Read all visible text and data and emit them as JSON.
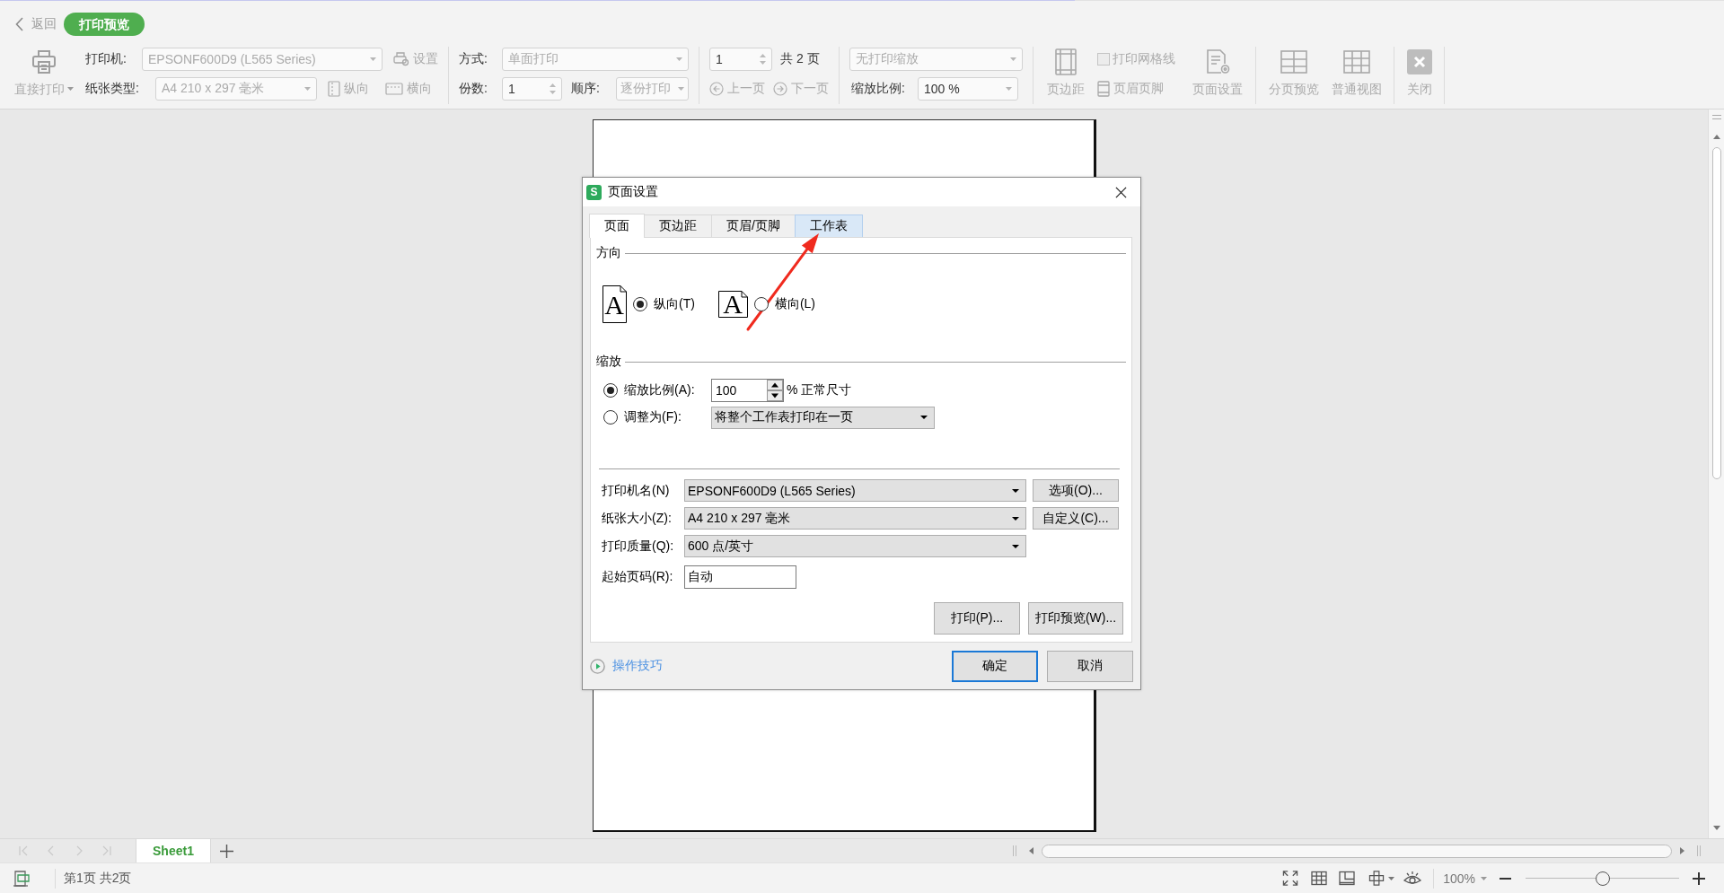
{
  "top_bar": {
    "back": "返回",
    "mode_badge": "打印预览"
  },
  "toolbar": {
    "direct_print": {
      "label": "直接打印",
      "disabled": true
    },
    "printer": {
      "label": "打印机:",
      "value": "EPSONF600D9 (L565 Series)",
      "disabled": true
    },
    "printer_settings": {
      "label": "设置",
      "disabled": true
    },
    "paper_type": {
      "label": "纸张类型:",
      "value": "A4 210 x 297 毫米",
      "disabled": true
    },
    "orientation": [
      {
        "kind": "portrait",
        "label": "纵向",
        "disabled": true
      },
      {
        "kind": "landscape",
        "label": "横向",
        "disabled": true
      }
    ],
    "print_mode": {
      "label": "方式:",
      "value": "单面打印",
      "disabled": true
    },
    "copies": {
      "label": "份数:",
      "value": "1"
    },
    "order": {
      "label": "顺序:",
      "value": "逐份打印",
      "disabled": true
    },
    "page_number": {
      "value": "1",
      "total": "共 2 页"
    },
    "page_nav": [
      {
        "kind": "prev",
        "label": "上一页",
        "disabled": true
      },
      {
        "kind": "next",
        "label": "下一页",
        "disabled": true
      }
    ],
    "print_scaling": {
      "value": "无打印缩放",
      "disabled": true
    },
    "zoom": {
      "label": "缩放比例:",
      "value": "100 %",
      "disabled": false
    },
    "margins": {
      "label": "页边距",
      "disabled": true
    },
    "gridlines": {
      "label": "打印网格线",
      "checked": false,
      "disabled": true
    },
    "header_footer": {
      "label": "页眉页脚",
      "disabled": true
    },
    "page_setup": {
      "label": "页面设置",
      "disabled": true
    },
    "views": [
      {
        "kind": "page_break",
        "label": "分页预览",
        "disabled": true
      },
      {
        "kind": "normal",
        "label": "普通视图",
        "disabled": true
      }
    ],
    "close": {
      "label": "关闭",
      "disabled": true
    }
  },
  "dialog": {
    "icon_letter": "S",
    "title": "页面设置",
    "tabs": [
      {
        "label": "页面",
        "selected": true,
        "hovered": false
      },
      {
        "label": "页边距",
        "selected": false,
        "hovered": false
      },
      {
        "label": "页眉/页脚",
        "selected": false,
        "hovered": false
      },
      {
        "label": "工作表",
        "selected": false,
        "hovered": true
      }
    ],
    "orientation": {
      "title": "方向",
      "options": [
        {
          "kind": "portrait",
          "icon_letter": "A",
          "label": "纵向(T)",
          "selected": true
        },
        {
          "kind": "landscape",
          "icon_letter": "A",
          "label": "横向(L)",
          "selected": false
        }
      ]
    },
    "scaling": {
      "title": "缩放",
      "options": [
        {
          "kind": "percent",
          "label": "缩放比例(A):",
          "selected": true,
          "value": "100",
          "suffix": "% 正常尺寸"
        },
        {
          "kind": "fit",
          "label": "调整为(F):",
          "selected": false,
          "value": "将整个工作表打印在一页"
        }
      ]
    },
    "fields": [
      {
        "kind": "select",
        "label": "打印机名(N)",
        "value": "EPSONF600D9 (L565 Series)",
        "button": "选项(O)..."
      },
      {
        "kind": "select",
        "label": "纸张大小(Z):",
        "value": "A4 210 x 297 毫米",
        "button": "自定义(C)..."
      },
      {
        "kind": "select",
        "label": "打印质量(Q):",
        "value": "600 点/英寸"
      },
      {
        "kind": "input",
        "label": "起始页码(R):",
        "value": "自动"
      }
    ],
    "actions": [
      "打印(P)...",
      "打印预览(W)..."
    ],
    "tips": "操作技巧",
    "buttons": [
      {
        "label": "确定",
        "focused": true
      },
      {
        "label": "取消",
        "focused": false
      }
    ]
  },
  "sheet_tabs": [
    {
      "label": "Sheet1",
      "selected": true
    }
  ],
  "status_bar": {
    "page_info": "第1页 共2页",
    "zoom": "100%",
    "zoom_slider": {
      "level": 0.5
    }
  }
}
